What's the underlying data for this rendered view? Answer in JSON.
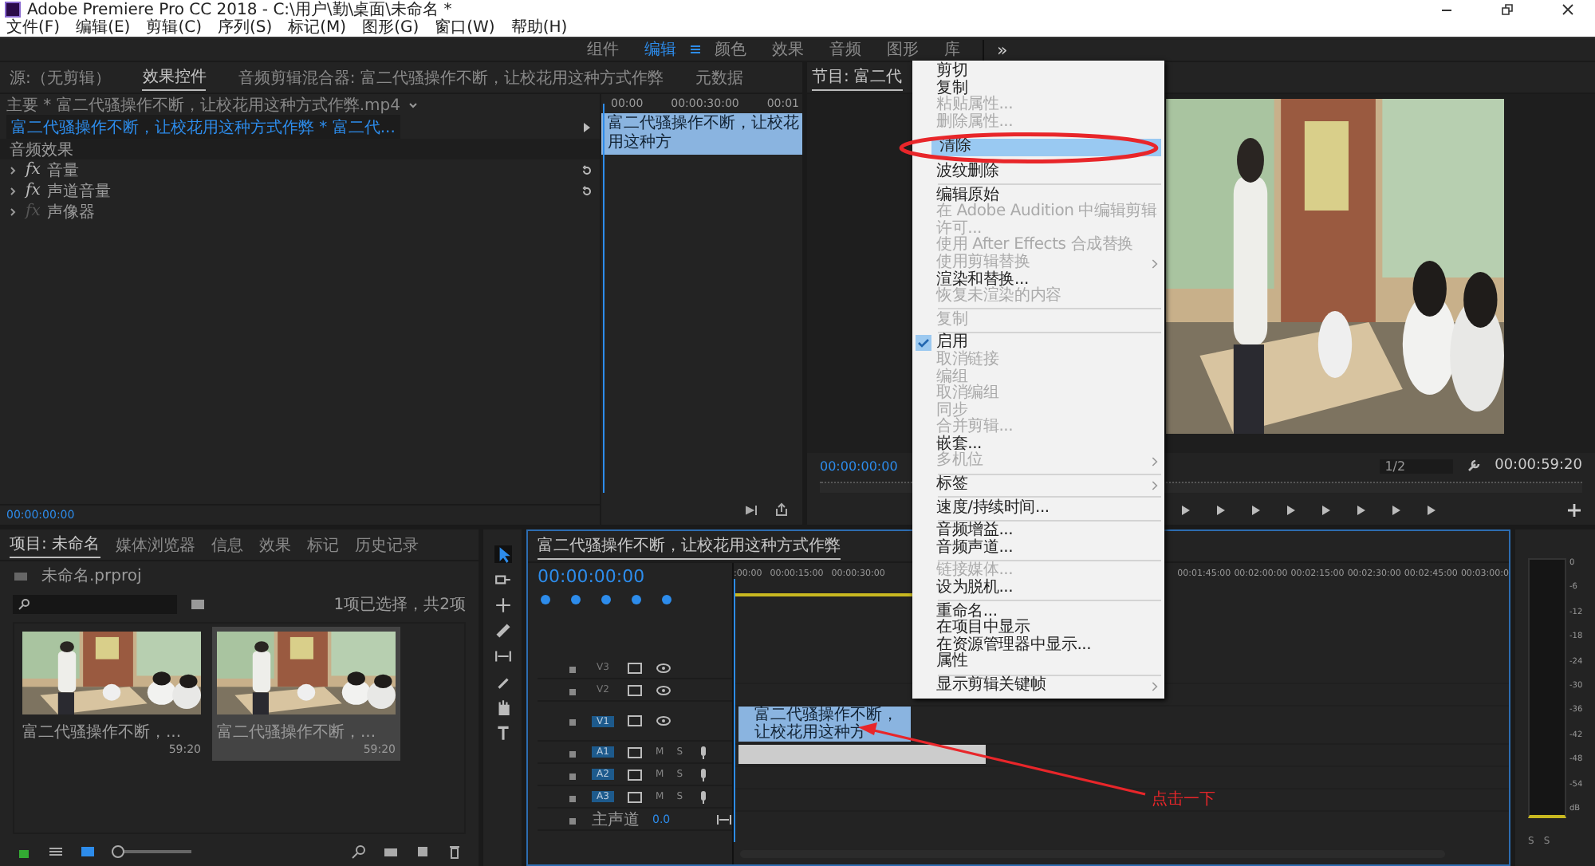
{
  "window": {
    "title": "Adobe Premiere Pro CC 2018 - C:\\用户\\勤\\桌面\\未命名 *"
  },
  "menu_bar": [
    "文件(F)",
    "编辑(E)",
    "剪辑(C)",
    "序列(S)",
    "标记(M)",
    "图形(G)",
    "窗口(W)",
    "帮助(H)"
  ],
  "workspaces": [
    {
      "label": "组件",
      "selected": false
    },
    {
      "label": "编辑",
      "selected": true
    },
    {
      "label": "颜色",
      "selected": false
    },
    {
      "label": "效果",
      "selected": false
    },
    {
      "label": "音频",
      "selected": false
    },
    {
      "label": "图形",
      "selected": false
    },
    {
      "label": "库",
      "selected": false
    }
  ],
  "workspace_overflow": "»",
  "effect_controls": {
    "tabs": [
      {
        "label": "源:（无剪辑）",
        "selected": false
      },
      {
        "label": "效果控件",
        "selected": true
      },
      {
        "label": "音频剪辑混合器: 富二代骚操作不断，让校花用这种方式作弊",
        "selected": false
      },
      {
        "label": "元数据",
        "selected": false
      }
    ],
    "master": "主要 * 富二代骚操作不断，让校花用这种方式作弊.mp4",
    "clip": "富二代骚操作不断，让校花用这种方式作弊 * 富二代...",
    "section": "音频效果",
    "effects": [
      {
        "icon_text": "fx",
        "name": "音量",
        "enabled": true
      },
      {
        "icon_text": "fx",
        "name": "声道音量",
        "enabled": true
      },
      {
        "icon_text": "fx",
        "name": "声像器",
        "enabled": false
      }
    ],
    "ruler": [
      "00:00",
      "00:00:30:00",
      "00:01"
    ],
    "clip_bar": "富二代骚操作不断，让校花用这种方",
    "timecode": "00:00:00:00"
  },
  "program_monitor": {
    "title": "节目: 富二代",
    "timecode": "00:00:00:00",
    "zoom": "1/2",
    "duration": "00:00:59:20"
  },
  "project": {
    "tabs": [
      {
        "label": "项目: 未命名",
        "selected": true
      },
      {
        "label": "媒体浏览器",
        "selected": false
      },
      {
        "label": "信息",
        "selected": false
      },
      {
        "label": "效果",
        "selected": false
      },
      {
        "label": "标记",
        "selected": false
      },
      {
        "label": "历史记录",
        "selected": false
      }
    ],
    "file": "未命名.prproj",
    "count": "1项已选择，共2项",
    "thumbnail_zoom": {
      "level": 0.05
    },
    "items": [
      {
        "name": "富二代骚操作不断，...",
        "duration": "59:20",
        "selected": false
      },
      {
        "name": "富二代骚操作不断，...",
        "duration": "59:20",
        "selected": true
      }
    ]
  },
  "timeline": {
    "title": "富二代骚操作不断，让校花用这种方式作弊",
    "timecode": "00:00:00:00",
    "ruler_left": [
      ":00:00",
      "00:00:15:00",
      "00:00:30:00"
    ],
    "ruler_right": [
      "00:01:45:00",
      "00:02:00:00",
      "00:02:15:00",
      "00:02:30:00",
      "00:02:45:00",
      "00:03:00:0"
    ],
    "video_tracks": [
      {
        "name": "V3",
        "targeted": false
      },
      {
        "name": "V2",
        "targeted": false
      },
      {
        "name": "V1",
        "targeted": true
      }
    ],
    "audio_tracks": [
      {
        "name": "A1",
        "targeted": true,
        "mute": "M",
        "solo": "S"
      },
      {
        "name": "A2",
        "targeted": true,
        "mute": "M",
        "solo": "S"
      },
      {
        "name": "A3",
        "targeted": true,
        "mute": "M",
        "solo": "S"
      }
    ],
    "master": {
      "label": "主声道",
      "value": "0.0"
    },
    "video_clip": "富二代骚操作不断，让校花用这种方"
  },
  "meter": {
    "ticks": [
      "0",
      "-6",
      "-12",
      "-18",
      "-24",
      "-30",
      "-36",
      "-42",
      "-48",
      "-54",
      "dB"
    ],
    "solo": [
      "S",
      "S"
    ]
  },
  "context_menu": [
    {
      "kind": "item",
      "label": "剪切",
      "disabled": false,
      "selected": false
    },
    {
      "kind": "item",
      "label": "复制",
      "disabled": false,
      "selected": false
    },
    {
      "kind": "item",
      "label": "粘贴属性...",
      "disabled": true,
      "selected": false
    },
    {
      "kind": "item",
      "label": "删除属性...",
      "disabled": true,
      "selected": false
    },
    {
      "kind": "item",
      "label": "清除",
      "disabled": false,
      "selected": true
    },
    {
      "kind": "item",
      "label": "波纹删除",
      "disabled": false,
      "selected": false
    },
    {
      "kind": "separator"
    },
    {
      "kind": "item",
      "label": "编辑原始",
      "disabled": false,
      "selected": false
    },
    {
      "kind": "item",
      "label": "在 Adobe Audition 中编辑剪辑",
      "disabled": true,
      "selected": false
    },
    {
      "kind": "item",
      "label": "许可...",
      "disabled": true,
      "selected": false
    },
    {
      "kind": "item",
      "label": "使用 After Effects 合成替换",
      "disabled": true,
      "selected": false
    },
    {
      "kind": "submenu",
      "label": "使用剪辑替换",
      "disabled": true,
      "selected": false
    },
    {
      "kind": "item",
      "label": "渲染和替换...",
      "disabled": false,
      "selected": false
    },
    {
      "kind": "item",
      "label": "恢复未渲染的内容",
      "disabled": true,
      "selected": false
    },
    {
      "kind": "separator"
    },
    {
      "kind": "item",
      "label": "复制",
      "disabled": true,
      "selected": false
    },
    {
      "kind": "separator"
    },
    {
      "kind": "item",
      "label": "启用",
      "disabled": false,
      "selected": false,
      "checked": true
    },
    {
      "kind": "item",
      "label": "取消链接",
      "disabled": true,
      "selected": false
    },
    {
      "kind": "item",
      "label": "编组",
      "disabled": true,
      "selected": false
    },
    {
      "kind": "item",
      "label": "取消编组",
      "disabled": true,
      "selected": false
    },
    {
      "kind": "item",
      "label": "同步",
      "disabled": true,
      "selected": false
    },
    {
      "kind": "item",
      "label": "合并剪辑...",
      "disabled": true,
      "selected": false
    },
    {
      "kind": "item",
      "label": "嵌套...",
      "disabled": false,
      "selected": false
    },
    {
      "kind": "submenu",
      "label": "多机位",
      "disabled": true,
      "selected": false
    },
    {
      "kind": "separator"
    },
    {
      "kind": "submenu",
      "label": "标签",
      "disabled": false,
      "selected": false
    },
    {
      "kind": "separator"
    },
    {
      "kind": "item",
      "label": "速度/持续时间...",
      "disabled": false,
      "selected": false
    },
    {
      "kind": "separator"
    },
    {
      "kind": "item",
      "label": "音频增益...",
      "disabled": false,
      "selected": false
    },
    {
      "kind": "item",
      "label": "音频声道...",
      "disabled": false,
      "selected": false
    },
    {
      "kind": "separator"
    },
    {
      "kind": "item",
      "label": "链接媒体...",
      "disabled": true,
      "selected": false
    },
    {
      "kind": "item",
      "label": "设为脱机...",
      "disabled": false,
      "selected": false
    },
    {
      "kind": "separator"
    },
    {
      "kind": "item",
      "label": "重命名...",
      "disabled": false,
      "selected": false
    },
    {
      "kind": "item",
      "label": "在项目中显示",
      "disabled": false,
      "selected": false
    },
    {
      "kind": "item",
      "label": "在资源管理器中显示...",
      "disabled": false,
      "selected": false
    },
    {
      "kind": "item",
      "label": "属性",
      "disabled": false,
      "selected": false
    },
    {
      "kind": "separator"
    },
    {
      "kind": "submenu",
      "label": "显示剪辑关键帧",
      "disabled": false,
      "selected": false
    }
  ],
  "annotation": {
    "label": "点击一下"
  }
}
